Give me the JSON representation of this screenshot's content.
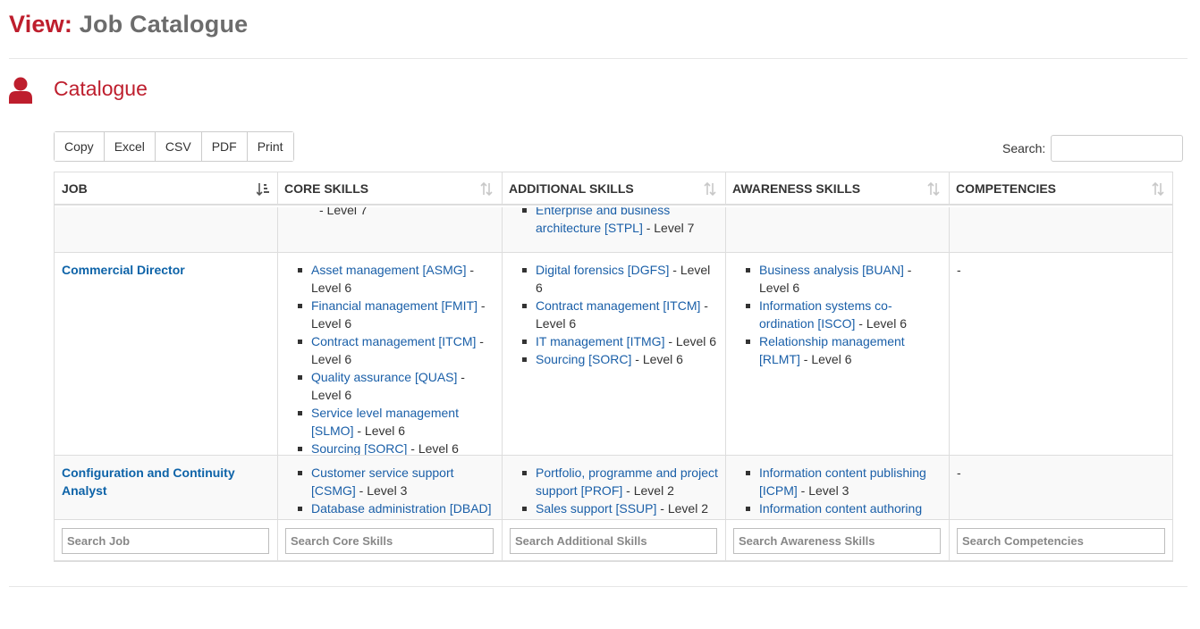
{
  "header": {
    "prefix": "View:",
    "title": "Job Catalogue"
  },
  "section": {
    "title": "Catalogue",
    "icon": "user-icon"
  },
  "toolbar": {
    "buttons": [
      "Copy",
      "Excel",
      "CSV",
      "PDF",
      "Print"
    ]
  },
  "search": {
    "label": "Search:",
    "value": ""
  },
  "table": {
    "columns": [
      "JOB",
      "CORE SKILLS",
      "ADDITIONAL SKILLS",
      "AWARENESS SKILLS",
      "COMPETENCIES"
    ],
    "rows": [
      {
        "job": "",
        "core": [
          {
            "name": "",
            "level": "- Level 7"
          }
        ],
        "additional": [
          {
            "name": "Enterprise and business architecture [STPL]",
            "level": " - Level 7"
          }
        ],
        "awareness": [],
        "competencies": ""
      },
      {
        "job": "Commercial Director",
        "core": [
          {
            "name": "Asset management [ASMG]",
            "level": " - Level 6"
          },
          {
            "name": "Financial management [FMIT]",
            "level": " - Level 6"
          },
          {
            "name": "Contract management [ITCM]",
            "level": " - Level 6"
          },
          {
            "name": "Quality assurance [QUAS]",
            "level": " - Level 6"
          },
          {
            "name": "Service level management [SLMO]",
            "level": " - Level 6"
          },
          {
            "name": "Sourcing [SORC]",
            "level": " - Level 6"
          }
        ],
        "additional": [
          {
            "name": "Digital forensics [DGFS]",
            "level": " - Level 6"
          },
          {
            "name": "Contract management [ITCM]",
            "level": " - Level 6"
          },
          {
            "name": "IT management [ITMG]",
            "level": " - Level 6"
          },
          {
            "name": "Sourcing [SORC]",
            "level": " - Level 6"
          }
        ],
        "awareness": [
          {
            "name": "Business analysis [BUAN]",
            "level": " - Level 6"
          },
          {
            "name": "Information systems co-ordination [ISCO]",
            "level": " - Level 6"
          },
          {
            "name": "Relationship management [RLMT]",
            "level": " - Level 6"
          }
        ],
        "competencies": "-"
      },
      {
        "job": "Configuration and Continuity Analyst",
        "core": [
          {
            "name": "Customer service support [CSMG]",
            "level": " - Level 3"
          },
          {
            "name": "Database administration [DBAD]",
            "level": " -"
          }
        ],
        "additional": [
          {
            "name": "Portfolio, programme and project support [PROF]",
            "level": " - Level 2"
          },
          {
            "name": "Sales support [SSUP]",
            "level": " - Level 2"
          }
        ],
        "awareness": [
          {
            "name": "Information content publishing [ICPM]",
            "level": " - Level 3"
          },
          {
            "name": "Information content authoring",
            "level": ""
          }
        ],
        "competencies": "-"
      }
    ]
  },
  "footer_filters": [
    "Search Job",
    "Search Core Skills",
    "Search Additional Skills",
    "Search Awareness Skills",
    "Search Competencies"
  ],
  "colors": {
    "accent": "#be1e2d",
    "link": "#1a5fa8",
    "border": "#dddddd"
  }
}
